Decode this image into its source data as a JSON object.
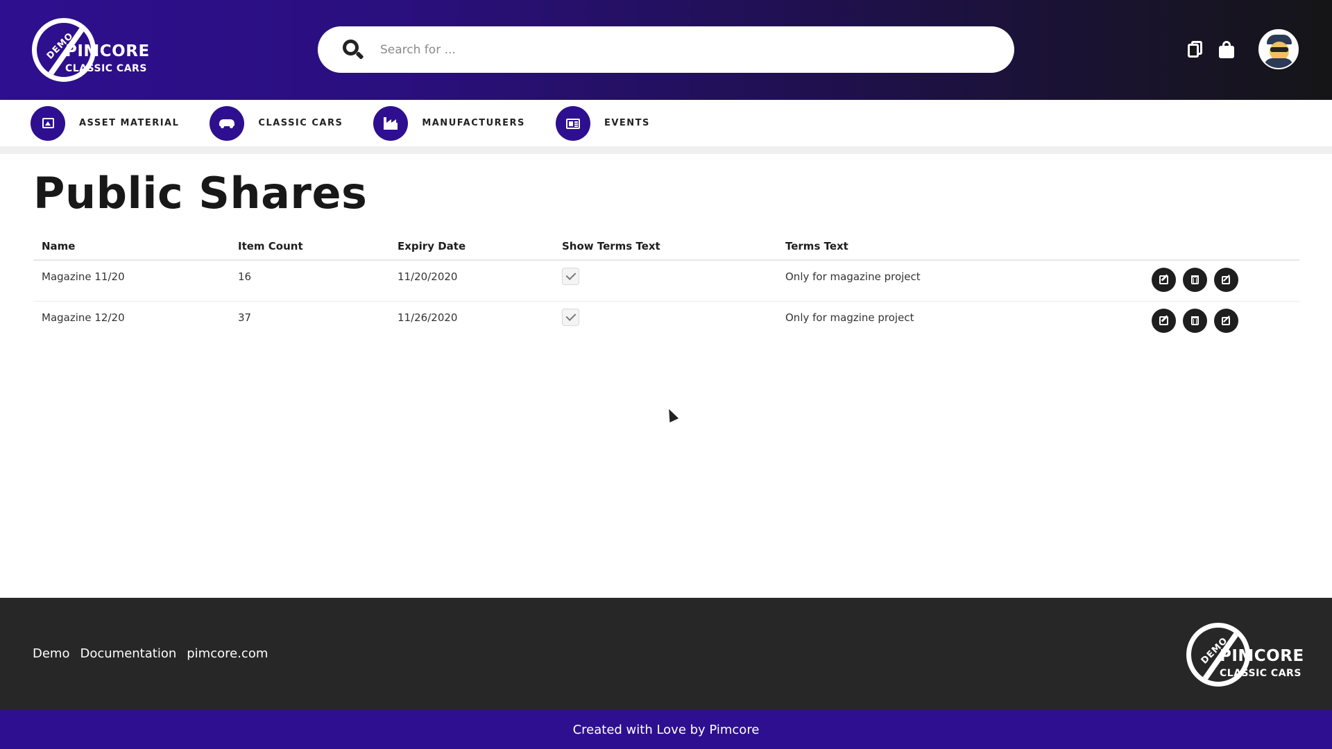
{
  "header": {
    "logo": {
      "badge": "DEMO",
      "brand": "PIMCORE",
      "sub": "CLASSIC CARS"
    },
    "search": {
      "placeholder": "Search for ...",
      "value": ""
    },
    "icons": [
      "copy-icon",
      "shopping-bag-icon",
      "avatar"
    ]
  },
  "nav": {
    "items": [
      {
        "label": "ASSET MATERIAL",
        "icon": "image-icon"
      },
      {
        "label": "CLASSIC CARS",
        "icon": "car-icon"
      },
      {
        "label": "MANUFACTURERS",
        "icon": "factory-icon"
      },
      {
        "label": "EVENTS",
        "icon": "newspaper-icon"
      }
    ]
  },
  "main": {
    "title": "Public Shares",
    "table": {
      "headers": [
        "Name",
        "Item Count",
        "Expiry Date",
        "Show Terms Text",
        "Terms Text"
      ],
      "rows": [
        {
          "name": "Magazine 11/20",
          "item_count": "16",
          "expiry_date": "11/20/2020",
          "show_terms_text": true,
          "terms_text": "Only for magazine project"
        },
        {
          "name": "Magazine 12/20",
          "item_count": "37",
          "expiry_date": "11/26/2020",
          "show_terms_text": true,
          "terms_text": "Only for magzine project"
        }
      ],
      "row_actions": [
        "edit-icon",
        "trash-icon",
        "external-link-icon"
      ]
    }
  },
  "footer": {
    "links": [
      "Demo",
      "Documentation",
      "pimcore.com"
    ],
    "logo": {
      "badge": "DEMO",
      "brand": "PIMCORE",
      "sub": "CLASSIC CARS"
    },
    "credit": "Created with Love by Pimcore"
  },
  "colors": {
    "brand_purple": "#2e0f8f",
    "header_dark": "#151517",
    "footer_dark": "#272727"
  }
}
